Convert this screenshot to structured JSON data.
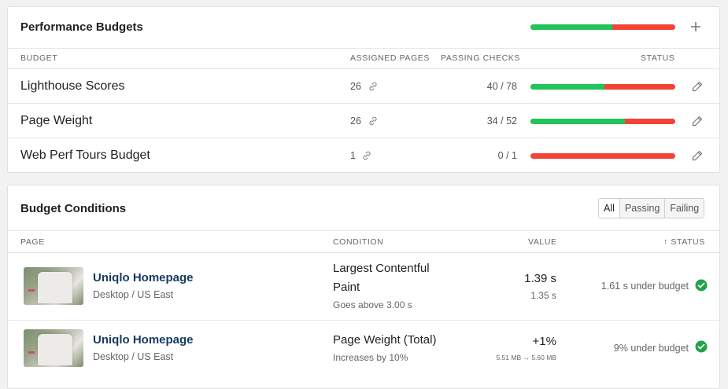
{
  "budgets": {
    "title": "Performance Budgets",
    "summary_pass_ratio": 0.565,
    "columns": {
      "budget": "BUDGET",
      "assigned": "ASSIGNED PAGES",
      "passing": "PASSING CHECKS",
      "status": "STATUS"
    },
    "rows": [
      {
        "name": "Lighthouse Scores",
        "assigned": "26",
        "checks": "40 / 78",
        "pass_ratio": 0.513
      },
      {
        "name": "Page Weight",
        "assigned": "26",
        "checks": "34 / 52",
        "pass_ratio": 0.654
      },
      {
        "name": "Web Perf Tours Budget",
        "assigned": "1",
        "checks": "0 / 1",
        "pass_ratio": 0.0
      }
    ]
  },
  "conditions": {
    "title": "Budget Conditions",
    "filters": [
      "All",
      "Passing",
      "Failing"
    ],
    "active_filter": "All",
    "columns": {
      "page": "PAGE",
      "condition": "CONDITION",
      "value": "VALUE",
      "status": "↑ STATUS"
    },
    "rows": [
      {
        "page_name": "Uniqlo Homepage",
        "page_sub": "Desktop / US East",
        "condition_line1": "Largest Contentful",
        "condition_line2": "Paint",
        "condition_sub": "Goes above 3.00 s",
        "value": "1.39 s",
        "value_sub": "1.35 s",
        "status": "1.61 s under budget"
      },
      {
        "page_name": "Uniqlo Homepage",
        "page_sub": "Desktop / US East",
        "condition_line1": "Page Weight (Total)",
        "condition_sub": "Increases by 10%",
        "value": "+1%",
        "value_sub": "5.51 MB → 5.60 MB",
        "status": "9% under budget"
      }
    ]
  },
  "colors": {
    "pass": "#21c45a",
    "fail": "#f44336",
    "link": "#163a5c",
    "ok": "#22a34a"
  },
  "icons": {
    "add": "plus-icon",
    "link": "link-icon",
    "edit": "pencil-icon",
    "ok": "check-circle-icon"
  }
}
